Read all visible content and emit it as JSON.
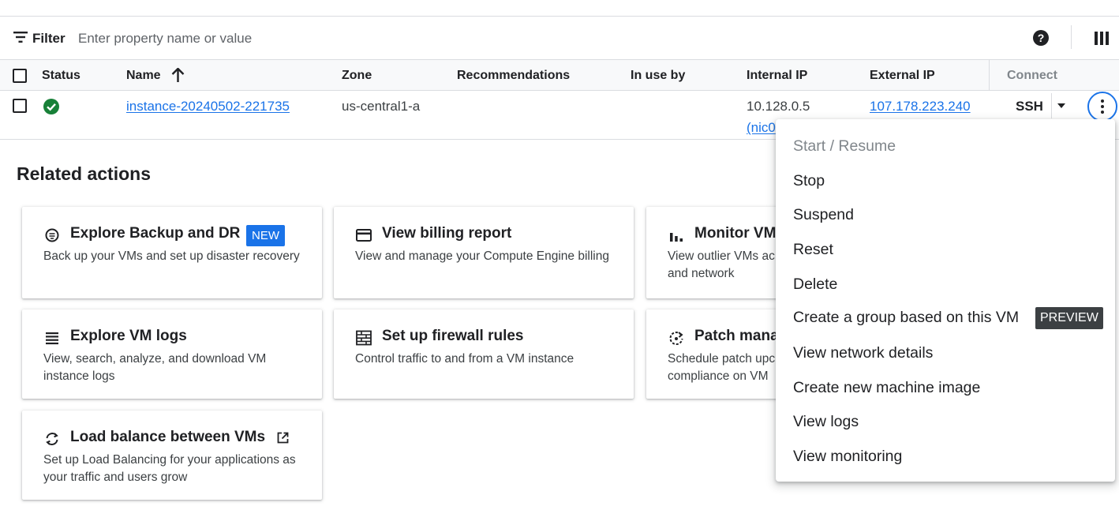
{
  "filter": {
    "label": "Filter",
    "placeholder": "Enter property name or value"
  },
  "table": {
    "headers": {
      "status": "Status",
      "name": "Name",
      "zone": "Zone",
      "recommendations": "Recommendations",
      "in_use_by": "In use by",
      "internal_ip": "Internal IP",
      "external_ip": "External IP",
      "connect": "Connect"
    },
    "row": {
      "name": "instance-20240502-221735",
      "zone": "us-central1-a",
      "internal_ip": "10.128.0.5",
      "internal_ip_nic": "(nic0",
      "external_ip": "107.178.223.240",
      "connect_label": "SSH",
      "status": "running"
    }
  },
  "related": {
    "title": "Related actions",
    "cards": [
      {
        "title": "Explore Backup and DR",
        "badge": "NEW",
        "desc": "Back up your VMs and set up disaster recovery",
        "icon": "backup-icon"
      },
      {
        "title": "View billing report",
        "desc": "View and manage your Compute Engine billing",
        "icon": "credit-card-icon"
      },
      {
        "title": "Monitor VM",
        "desc": "View outlier VMs ac and network",
        "icon": "bar-chart-icon"
      },
      {
        "title": "Explore VM logs",
        "desc": "View, search, analyze, and download VM instance logs",
        "icon": "logs-icon"
      },
      {
        "title": "Set up firewall rules",
        "desc": "Control traffic to and from a VM instance",
        "icon": "firewall-icon"
      },
      {
        "title": "Patch mana",
        "desc": "Schedule patch upc compliance on VM",
        "icon": "patch-icon"
      },
      {
        "title": "Load balance between VMs",
        "desc": "Set up Load Balancing for your applications as your traffic and users grow",
        "icon": "load-balance-icon"
      }
    ]
  },
  "menu": {
    "items": [
      {
        "label": "Start / Resume",
        "disabled": true
      },
      {
        "label": "Stop"
      },
      {
        "label": "Suspend"
      },
      {
        "label": "Reset"
      },
      {
        "label": "Delete"
      },
      {
        "label": "Create a group based on this VM",
        "badge": "PREVIEW"
      },
      {
        "label": "View network details"
      },
      {
        "label": "Create new machine image"
      },
      {
        "label": "View logs"
      },
      {
        "label": "View monitoring"
      }
    ]
  },
  "colors": {
    "accent": "#1a73e8",
    "success": "#188038",
    "preview_badge": "#3c4043"
  }
}
